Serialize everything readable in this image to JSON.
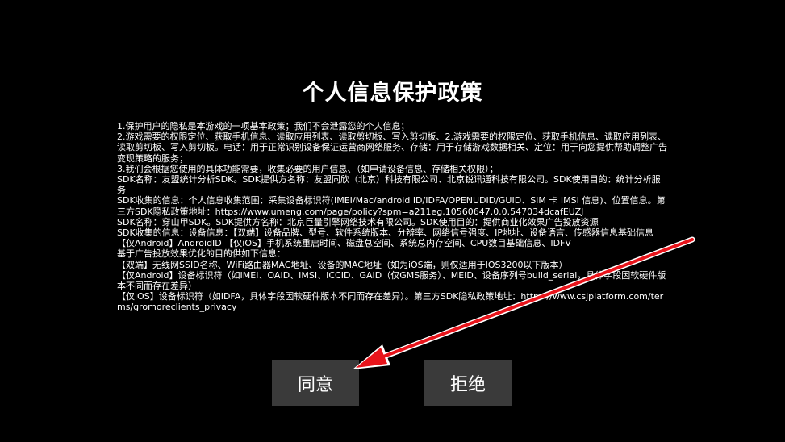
{
  "dialog": {
    "title": "个人信息保护政策",
    "policy_lines": [
      "1.保护用户的隐私是本游戏的一项基本政策；我们不会泄露您的个人信息；",
      "2.游戏需要的权限定位、获取手机信息、读取应用列表、读取剪切板、写入剪切板、2.游戏需要的权限定位、获取手机信息、读取应用列表、读取剪切板、写入剪切板。电话：用于正常识别设备保证运营商网络服务、存储：用于存储游戏数据相关、定位：用于向您提供帮助调整广告变现策略的服务；",
      "3.我们会根据您使用的具体功能需要，收集必要的用户信息、（如申请设备信息、存储相关权限）；",
      "SDK名称：友盟统计分析SDK。SDK提供方名称：友盟同欣（北京）科技有限公司、北京锐讯通科技有限公司。SDK使用目的：统计分析服务",
      "SDK收集的信息：个人信息收集范围：采集设备标识符(IMEI/Mac/android ID/IDFA/OPENUDID/GUID、SIM 卡 IMSI 信息)、位置信息。第三方SDK隐私政策地址：https://www.umeng.com/page/policy?spm=a211eg.10560647.0.0.547034dcafEUZJ",
      "SDK名称：穿山甲SDK。SDK提供方名称：北京巨量引擎网络技术有限公司。SDK使用目的：提供商业化效果广告投放资源",
      "SDK收集的信息：设备信息：【双端】设备品牌、型号、软件系统版本、分辨率、网络信号强度、IP地址、设备语言、传感器信息基础信息",
      "【仅Android】AndroidID 【仅iOS】手机系统重启时间、磁盘总空间、系统总内存空间、CPU数目基础信息、IDFV",
      "基于广告投放效果优化的目的供如下信息：",
      "【双端】无线网SSID名称、WiFi路由器MAC地址、设备的MAC地址（如为iOS端，则仅适用于IOS3200以下版本）",
      "【仅Android】设备标识符（如IMEI、OAID、IMSI、ICCID、GAID（仅GMS服务）、MEID、设备序列号build_serial，具体字段因软硬件版本不同而存在差异）",
      "【仅iOS】设备标识符（如IDFA，具体字段因软硬件版本不同而存在差异）。第三方SDK隐私政策地址：https://www.csjplatform.com/terms/gromoreclients_privacy"
    ]
  },
  "buttons": {
    "agree_label": "同意",
    "reject_label": "拒绝"
  },
  "colors": {
    "background": "#000000",
    "text": "#ffffff",
    "button_bg": "#3a3a3a",
    "annotation_arrow": "#e8141b"
  },
  "icons": {
    "annotation": "red-arrow-icon"
  }
}
